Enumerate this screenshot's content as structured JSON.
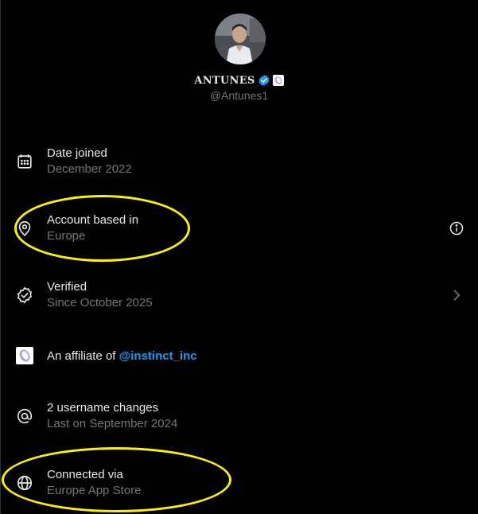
{
  "profile": {
    "display_name": "ANTUNES",
    "handle": "@Antunes1"
  },
  "rows": [
    {
      "title": "Date joined",
      "subtitle": "December 2022",
      "icon": "calendar-icon"
    },
    {
      "title": "Account based in",
      "subtitle": "Europe",
      "icon": "location-pin-icon",
      "trailing_icon": "info-icon"
    },
    {
      "title": "Verified",
      "subtitle": "Since October 2025",
      "icon": "verified-check-icon",
      "trailing_icon": "chevron-right-icon"
    },
    {
      "title_prefix": "An affiliate of ",
      "mention": "@instinct_inc",
      "icon": "affiliate-logo-icon"
    },
    {
      "title": "2 username changes",
      "subtitle": "Last on September 2024",
      "icon": "at-sign-icon"
    },
    {
      "title": "Connected via",
      "subtitle": "Europe App Store",
      "icon": "globe-icon"
    }
  ],
  "colors": {
    "background": "#000000",
    "text_primary": "#e7e9ea",
    "text_secondary": "#71767b",
    "accent_blue": "#1d9bf0",
    "annotation_yellow": "#fff200"
  }
}
